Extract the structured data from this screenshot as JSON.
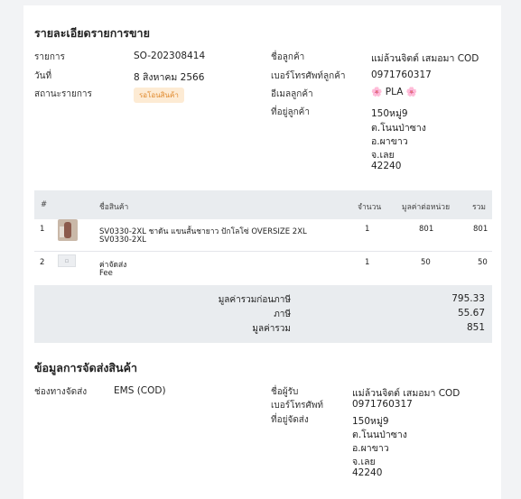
{
  "order": {
    "section_title": "รายละเอียดรายการขาย",
    "labels": {
      "order_no": "รายการ",
      "date": "วันที่",
      "status": "สถานะรายการ",
      "customer_name": "ชื่อลูกค้า",
      "phone": "เบอร์โทรศัพท์ลูกค้า",
      "email": "อีเมลลูกค้า",
      "address": "ที่อยู่ลูกค้า"
    },
    "order_no": "SO-202308414",
    "date": "8 สิงหาคม 2566",
    "status_badge": "รอโอนสินค้า",
    "customer_name": "แม่ล้วนจิตต์ เสมอมา COD",
    "phone": "0971760317",
    "email_text": "PLA",
    "email_flower": "🌸",
    "address_lines": [
      "150หมู่9",
      "ต.โนนป่าซาง",
      "อ.ผาขาว",
      "จ.เลย",
      "42240"
    ]
  },
  "table": {
    "headers": {
      "index": "#",
      "product": "ชื่อสินค้า",
      "qty": "จำนวน",
      "unit_price": "มูลค่าต่อหน่วย",
      "total": "รวม"
    },
    "rows": [
      {
        "index": "1",
        "name": "SV0330-2XL ชาดัน แขนสั้นชายาว ปักโลโซ่ OVERSIZE 2XL",
        "sku": "SV0330-2XL",
        "qty": "1",
        "unit_price": "801",
        "total": "801"
      },
      {
        "index": "2",
        "name": "ค่าจัดส่ง",
        "sku": "Fee",
        "qty": "1",
        "unit_price": "50",
        "total": "50"
      }
    ],
    "thumb2_glyph": "▫"
  },
  "summary": {
    "subtotal_label": "มูลค่ารวมก่อนภาษี",
    "subtotal": "795.33",
    "tax_label": "ภาษี",
    "tax": "55.67",
    "total_label": "มูลค่ารวม",
    "total": "851"
  },
  "shipping": {
    "section_title": "ข้อมูลการจัดส่งสินค้า",
    "labels": {
      "channel": "ช่องทางจัดส่ง",
      "recipient": "ชื่อผู้รับ",
      "phone": "เบอร์โทรศัพท์",
      "address": "ที่อยู่จัดส่ง"
    },
    "channel": "EMS (COD)",
    "recipient": "แม่ล้วนจิตต์ เสมอมา COD",
    "phone": "0971760317",
    "address_lines": [
      "150หมู่9",
      "ต.โนนป่าซาง",
      "อ.ผาขาว",
      "จ.เลย",
      "42240"
    ]
  }
}
